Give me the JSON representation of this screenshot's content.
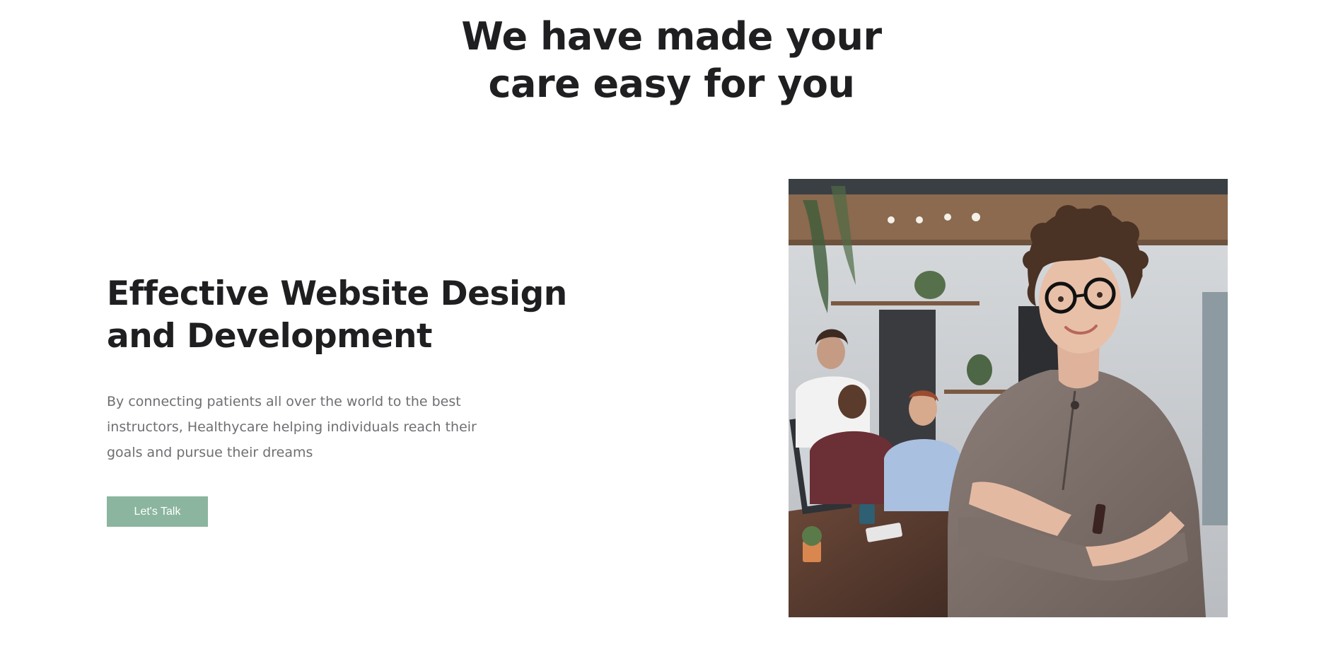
{
  "section": {
    "title_line1": "We have made your",
    "title_line2": "care easy for you"
  },
  "feature": {
    "heading_line1": "Effective Website Design",
    "heading_line2": "and Development",
    "description": "By connecting patients all over the world to the best instructors, Healthycare helping individuals reach their goals and pursue their dreams",
    "button_label": "Let's Talk"
  },
  "colors": {
    "heading": "#1f1f21",
    "body_text": "#6f6f73",
    "button_bg": "#8bb59f",
    "button_text": "#ffffff"
  },
  "image": {
    "subject": "smiling woman with glasses and arms crossed in an office with colleagues"
  }
}
